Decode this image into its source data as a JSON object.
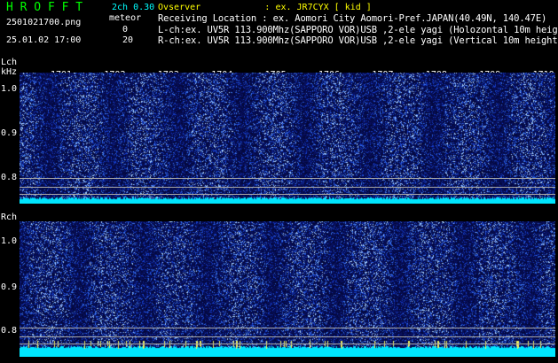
{
  "header": {
    "app_title": "H R O F F T",
    "version": "2ch 0.30",
    "mode_label": "meteor",
    "filename": "2501021700.png",
    "datetime": "25.01.02 17:00",
    "count_lch": "0",
    "count_rch": "20",
    "observer": "Ovserver            : ex. JR7CYX [ kid ]",
    "location": "Receiving Location : ex. Aomori City Aomori-Pref.JAPAN(40.49N, 140.47E)",
    "lch_info": "L-ch:ex. UV5R 113.900Mhz(SAPPORO VOR)USB ,2-ele yagi (Holozontal 10m height)",
    "rch_info": "R-ch:ex. UV5R 113.900Mhz(SAPPORO VOR)USB ,2-ele yagi (Vertical 10m height)"
  },
  "lch_panel": {
    "label": "Lch",
    "unit": "kHz",
    "y_ticks": [
      "1.0",
      "0.9",
      "0.8"
    ],
    "time_ticks": [
      "1701",
      "1702",
      "1703",
      "1704",
      "1705",
      "1706",
      "1707",
      "1708",
      "1709",
      "1710"
    ]
  },
  "rch_panel": {
    "label": "Rch",
    "y_ticks": [
      "1.0",
      "0.9",
      "0.8"
    ]
  },
  "colors": {
    "background": "#000000",
    "title_green": "#00ff00",
    "header_cyan": "#00ffff",
    "header_yellow": "#ffff00",
    "noise_floor": "#00e6ff",
    "spectrogram_base": "#0a1a8c"
  }
}
